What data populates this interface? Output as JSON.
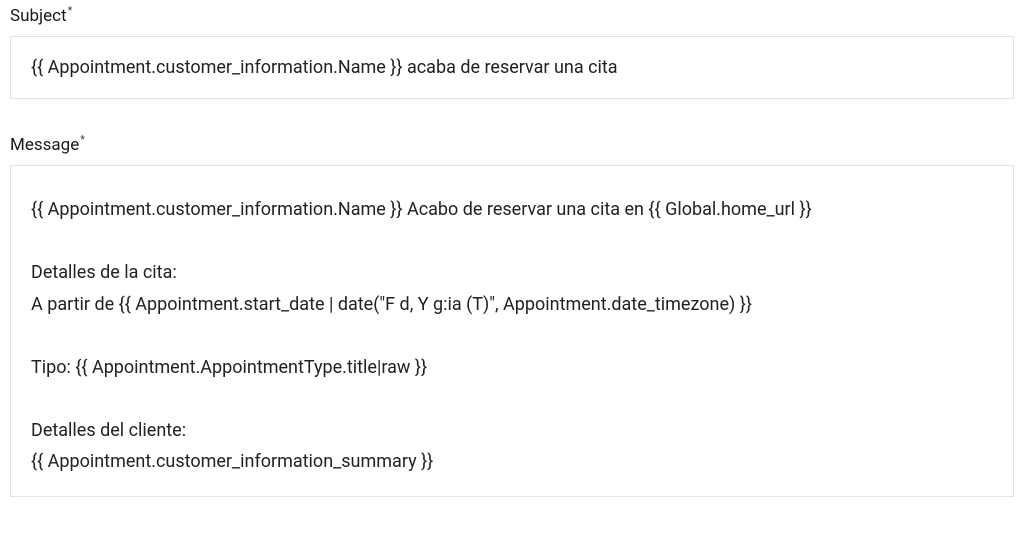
{
  "subject_field": {
    "label": "Subject",
    "required_mark": "*",
    "value": "{{ Appointment.customer_information.Name }} acaba de reservar una cita"
  },
  "message_field": {
    "label": "Message",
    "required_mark": "*",
    "value": "{{ Appointment.customer_information.Name }} Acabo de reservar una cita en {{ Global.home_url }}\n\nDetalles de la cita:\nA partir de {{ Appointment.start_date | date(\"F d, Y g:ia (T)\", Appointment.date_timezone) }}\n\nTipo: {{ Appointment.AppointmentType.title|raw }}\n\nDetalles del cliente:\n{{ Appointment.customer_information_summary }}"
  }
}
